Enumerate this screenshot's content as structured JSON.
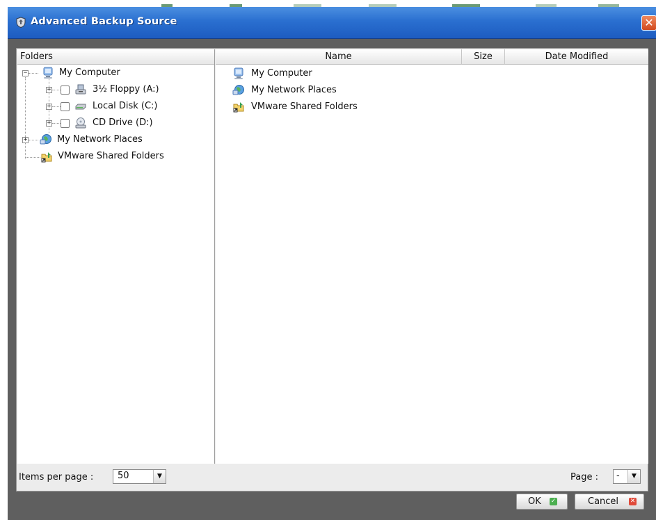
{
  "dialog": {
    "title": "Advanced Backup Source",
    "close_label": "✕"
  },
  "folders_pane": {
    "header": "Folders",
    "tree": [
      {
        "label": "My Computer",
        "icon": "computer-icon",
        "expander": "−"
      },
      {
        "label": "3½ Floppy (A:)",
        "icon": "floppy-drive-icon",
        "expander": "+",
        "checked": false
      },
      {
        "label": "Local Disk (C:)",
        "icon": "hard-disk-icon",
        "expander": "+",
        "checked": false
      },
      {
        "label": "CD Drive (D:)",
        "icon": "cd-drive-icon",
        "expander": "+",
        "checked": false
      },
      {
        "label": "My Network Places",
        "icon": "network-places-icon",
        "expander": "+"
      },
      {
        "label": "VMware Shared Folders",
        "icon": "shared-folder-icon"
      }
    ]
  },
  "files_pane": {
    "columns": [
      "Name",
      "Size",
      "Date Modified"
    ],
    "rows": [
      {
        "name": "My Computer",
        "icon": "computer-icon"
      },
      {
        "name": "My Network Places",
        "icon": "network-places-icon"
      },
      {
        "name": "VMware Shared Folders",
        "icon": "shared-folder-icon"
      }
    ]
  },
  "footer": {
    "items_per_page_label": "Items per page :",
    "items_per_page_value": "50",
    "page_label": "Page :",
    "page_value": "-"
  },
  "buttons": {
    "ok": "OK",
    "cancel": "Cancel"
  },
  "colors": {
    "title_bar": "#2a6fd0",
    "dialog_frame": "#5f5f5f",
    "ok_icon": "#4caf50",
    "cancel_icon": "#e04a3a"
  }
}
